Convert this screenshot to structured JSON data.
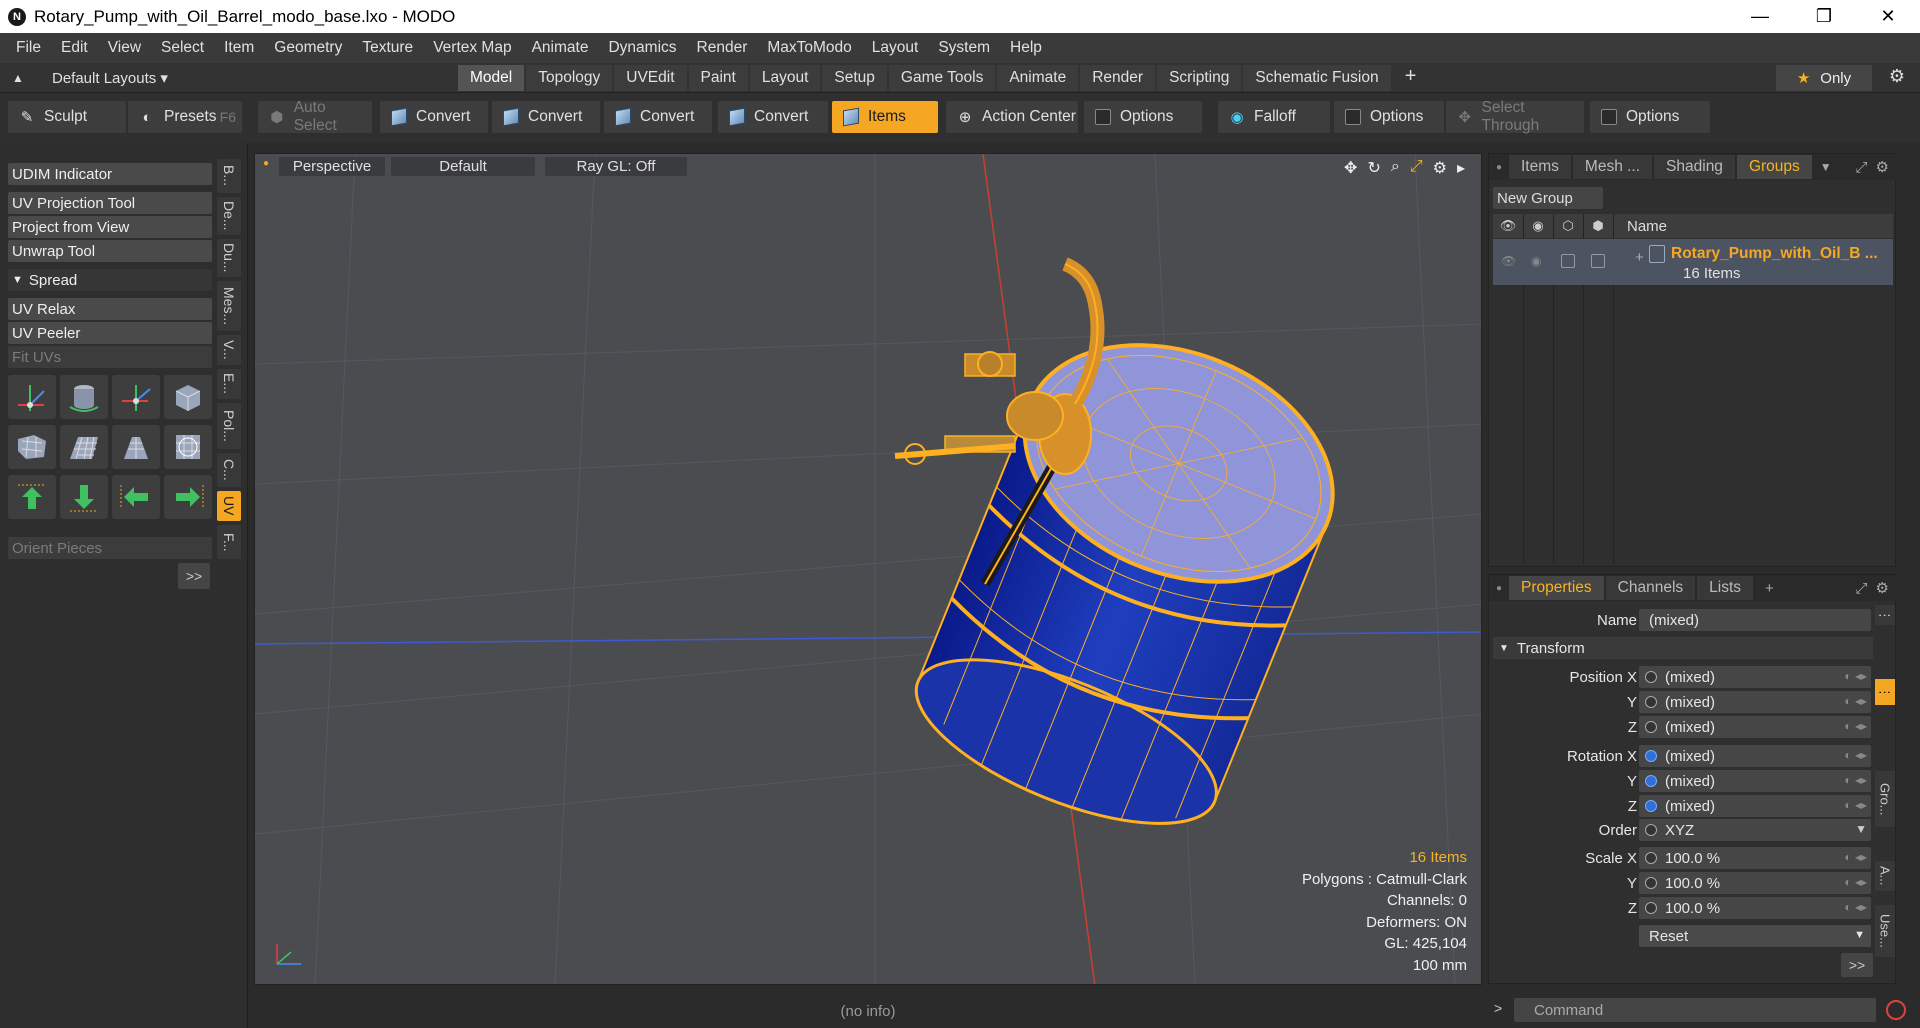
{
  "window": {
    "title": "Rotary_Pump_with_Oil_Barrel_modo_base.lxo - MODO",
    "app_icon": "N",
    "minimize": "—",
    "maximize": "❐",
    "close": "✕"
  },
  "menu": [
    "File",
    "Edit",
    "View",
    "Select",
    "Item",
    "Geometry",
    "Texture",
    "Vertex Map",
    "Animate",
    "Dynamics",
    "Render",
    "MaxToModo",
    "Layout",
    "System",
    "Help"
  ],
  "layouts": {
    "label": "Default Layouts ▾",
    "tabs": [
      "Model",
      "Topology",
      "UVEdit",
      "Paint",
      "Layout",
      "Setup",
      "Game Tools",
      "Animate",
      "Render",
      "Scripting",
      "Schematic Fusion"
    ],
    "active_tab": "Model",
    "plus": "+",
    "only_label": "Only"
  },
  "toolbar": {
    "sculpt": "Sculpt",
    "presets": "Presets",
    "presets_hint": "F6",
    "auto_select": "Auto Select",
    "convert1": "Convert",
    "convert2": "Convert",
    "convert3": "Convert",
    "convert4": "Convert",
    "items": "Items",
    "action_center": "Action Center",
    "options1": "Options",
    "falloff": "Falloff",
    "options2": "Options",
    "select_through": "Select Through",
    "options3": "Options"
  },
  "left_panel": {
    "udim": "UDIM Indicator",
    "uv_projection": "UV Projection Tool",
    "project_view": "Project from View",
    "unwrap": "Unwrap Tool",
    "spread": "Spread",
    "uv_relax": "UV Relax",
    "uv_peeler": "UV Peeler",
    "fit_uvs": "Fit UVs",
    "orient": "Orient Pieces",
    "expand": ">>",
    "vtabs": [
      "B...",
      "De...",
      "Du...",
      "Mes...",
      "V...",
      "E...",
      "Pol...",
      "C...",
      "UV",
      "F..."
    ]
  },
  "viewport": {
    "view": "Perspective",
    "shading": "Default",
    "raygl": "Ray GL: Off",
    "info_items": "16 Items",
    "info_polys": "Polygons : Catmull-Clark",
    "info_channels": "Channels: 0",
    "info_deformers": "Deformers: ON",
    "info_gl": "GL: 425,104",
    "info_scale": "100 mm",
    "status": "(no info)"
  },
  "groups_panel": {
    "tabs": [
      "Items",
      "Mesh ...",
      "Shading",
      "Groups"
    ],
    "active_tab": "Groups",
    "new_group": "New Group",
    "col_name": "Name",
    "group_name": "Rotary_Pump_with_Oil_B ...",
    "group_count": "16 Items"
  },
  "properties": {
    "tabs": [
      "Properties",
      "Channels",
      "Lists"
    ],
    "active_tab": "Properties",
    "plus": "+",
    "name_label": "Name",
    "name_value": "(mixed)",
    "transform": "Transform",
    "position_x_label": "Position X",
    "position_x": "(mixed)",
    "position_y_label": "Y",
    "position_y": "(mixed)",
    "position_z_label": "Z",
    "position_z": "(mixed)",
    "rotation_x_label": "Rotation X",
    "rotation_x": "(mixed)",
    "rotation_y_label": "Y",
    "rotation_y": "(mixed)",
    "rotation_z_label": "Z",
    "rotation_z": "(mixed)",
    "order_label": "Order",
    "order_value": "XYZ",
    "scale_x_label": "Scale X",
    "scale_x": "100.0 %",
    "scale_y_label": "Y",
    "scale_y": "100.0 %",
    "scale_z_label": "Z",
    "scale_z": "100.0 %",
    "reset": "Reset",
    "expand": ">>",
    "side_tabs": [
      "Gro...",
      "A...",
      "Use..."
    ]
  },
  "command": {
    "placeholder": "Command",
    "arrow": ">"
  },
  "colors": {
    "accent": "#f5a623",
    "barrel_blue": "#1f3fbf",
    "barrel_top": "#8f95d8",
    "wire": "#ffb020"
  }
}
